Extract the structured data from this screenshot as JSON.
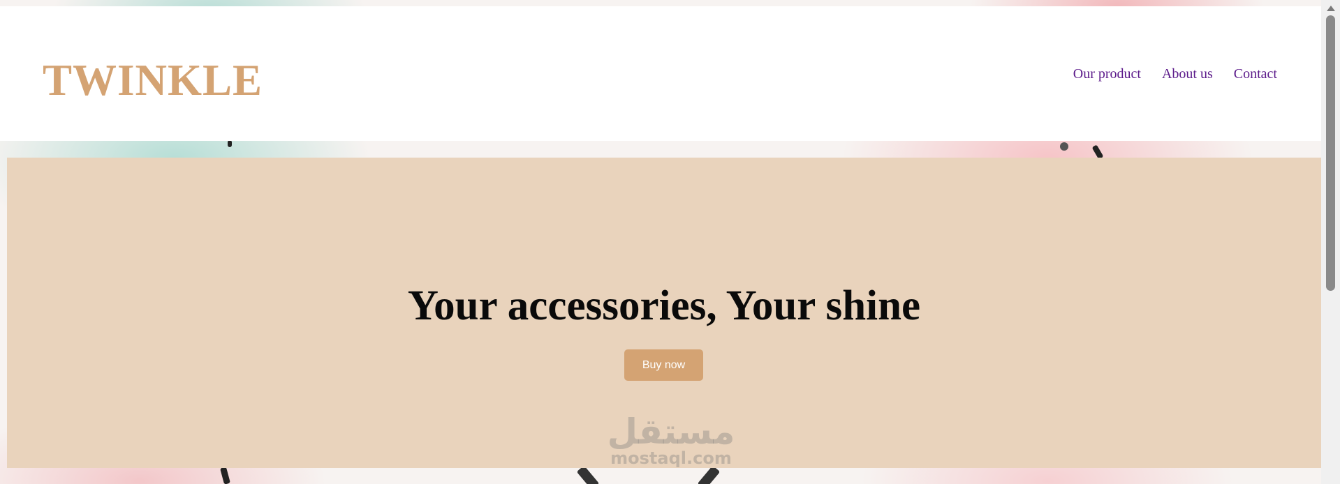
{
  "header": {
    "logo": "TWINKLE",
    "nav": [
      {
        "label": "Our product"
      },
      {
        "label": "About us"
      },
      {
        "label": "Contact"
      }
    ]
  },
  "hero": {
    "title": "Your accessories, Your shine",
    "button_label": "Buy now"
  },
  "watermark": {
    "arabic": "مستقل",
    "latin": "mostaql.com"
  },
  "colors": {
    "brand": "#d4a373",
    "hero_background": "#e9d3bc",
    "nav_link": "#5b1a8a"
  },
  "icons": {
    "scroll_up": "chevron-up-icon"
  }
}
